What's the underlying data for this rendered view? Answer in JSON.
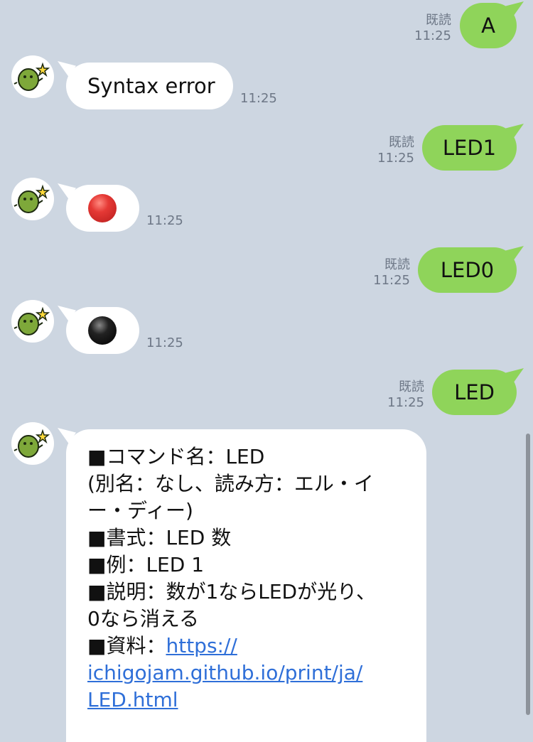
{
  "colors": {
    "background": "#cdd6e1",
    "outgoing_bubble": "#8fd45a",
    "incoming_bubble": "#ffffff",
    "link": "#2f6fd8"
  },
  "messages": [
    {
      "direction": "out",
      "text": "A",
      "read": "既読",
      "time": "11:25"
    },
    {
      "direction": "in",
      "text": "Syntax error",
      "time": "11:25"
    },
    {
      "direction": "out",
      "text": "LED1",
      "read": "既読",
      "time": "11:25"
    },
    {
      "direction": "in",
      "emoji": "red-circle",
      "time": "11:25"
    },
    {
      "direction": "out",
      "text": "LED0",
      "read": "既読",
      "time": "11:25"
    },
    {
      "direction": "in",
      "emoji": "black-circle",
      "time": "11:25"
    },
    {
      "direction": "out",
      "text": "LED",
      "read": "既読",
      "time": "11:25"
    },
    {
      "direction": "in",
      "lines": [
        "■コマンド名：LED",
        "(別名：なし、読み方：エル・イ",
        "ー・ディー)",
        "■書式：LED 数",
        "■例：LED 1",
        "■説明：数が1ならLEDが光り、",
        "0なら消える"
      ],
      "ref_label": "■資料：",
      "link_parts": [
        "https://",
        "ichigojam.github.io/print/ja/",
        "LED.html"
      ]
    }
  ],
  "avatar_icon": "bot-mascot-icon"
}
